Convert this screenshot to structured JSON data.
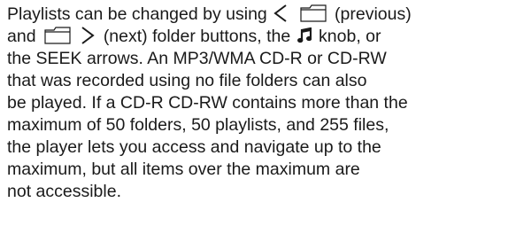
{
  "paragraph": {
    "l1_a": "Playlists can be changed by using",
    "l1_b": "(previous)",
    "l2_a": "and",
    "l2_b": "(next) folder buttons, the",
    "l2_c": "knob, or",
    "l3": "the SEEK arrows. An MP3/WMA CD-R or CD-RW",
    "l4": "that was recorded using no file folders can also",
    "l5": "be played. If a CD-R CD-RW contains more than the",
    "l6": "maximum of 50 folders, 50 playlists, and 255 files,",
    "l7": "the player lets you access and navigate up to the",
    "l8": "maximum, but all items over the maximum are",
    "l9": "not accessible."
  },
  "icons": {
    "previous": "chevron-left-icon",
    "next": "chevron-right-icon",
    "folder": "folder-icon",
    "knob": "music-note-icon"
  }
}
